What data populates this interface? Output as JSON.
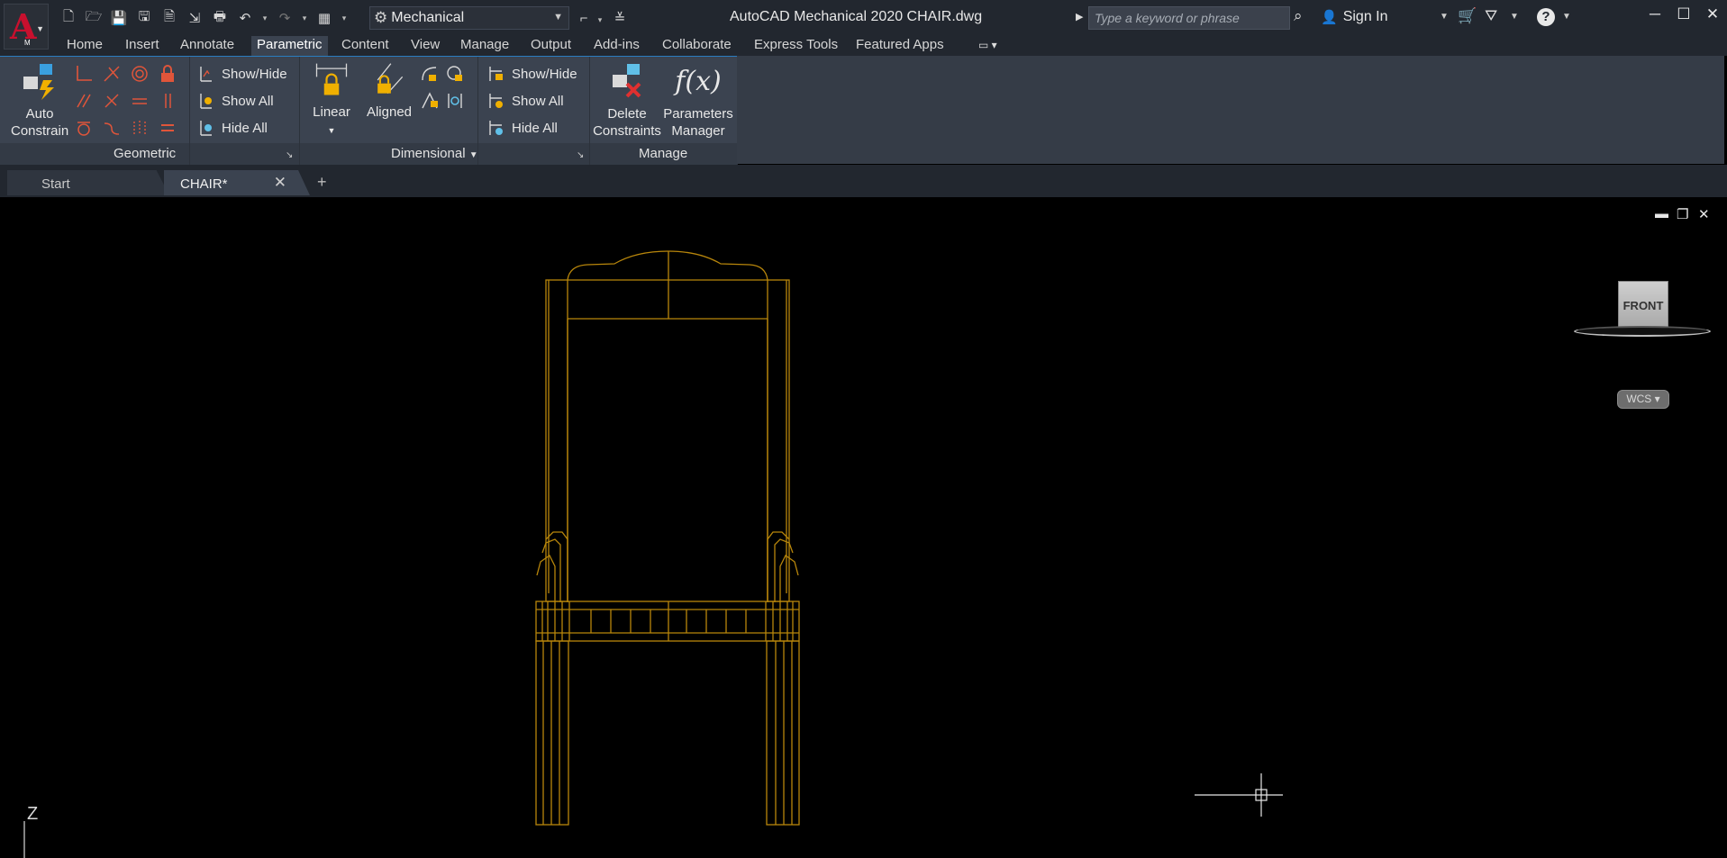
{
  "app": {
    "letter": "A",
    "sub": "M",
    "title": "AutoCAD Mechanical 2020    CHAIR.dwg"
  },
  "workspace": {
    "label": "Mechanical"
  },
  "search": {
    "placeholder": "Type a keyword or phrase"
  },
  "signin": {
    "label": "Sign In"
  },
  "ribbon_tabs": [
    "Home",
    "Insert",
    "Annotate",
    "Parametric",
    "Content",
    "View",
    "Manage",
    "Output",
    "Add-ins",
    "Collaborate",
    "Express Tools",
    "Featured Apps"
  ],
  "active_tab": "Parametric",
  "panels": {
    "geometric": {
      "title": "Geometric",
      "auto_constrain": [
        "Auto",
        "Constrain"
      ],
      "show_hide": "Show/Hide",
      "show_all": "Show All",
      "hide_all": "Hide All"
    },
    "dimensional": {
      "title": "Dimensional",
      "linear": "Linear",
      "aligned": "Aligned",
      "show_hide": "Show/Hide",
      "show_all": "Show All",
      "hide_all": "Hide All"
    },
    "manage": {
      "title": "Manage",
      "delete": [
        "Delete",
        "Constraints"
      ],
      "params": [
        "Parameters",
        "Manager"
      ],
      "fx": "f(x)"
    }
  },
  "doc_tabs": {
    "start": "Start",
    "active": "CHAIR*"
  },
  "viewcube": {
    "face": "FRONT",
    "wcs": "WCS"
  },
  "ucs": {
    "axis": "Z"
  },
  "colors": {
    "drawing_lines": "#b8860b",
    "accent": "#2a7dc0",
    "background": "#000000"
  }
}
